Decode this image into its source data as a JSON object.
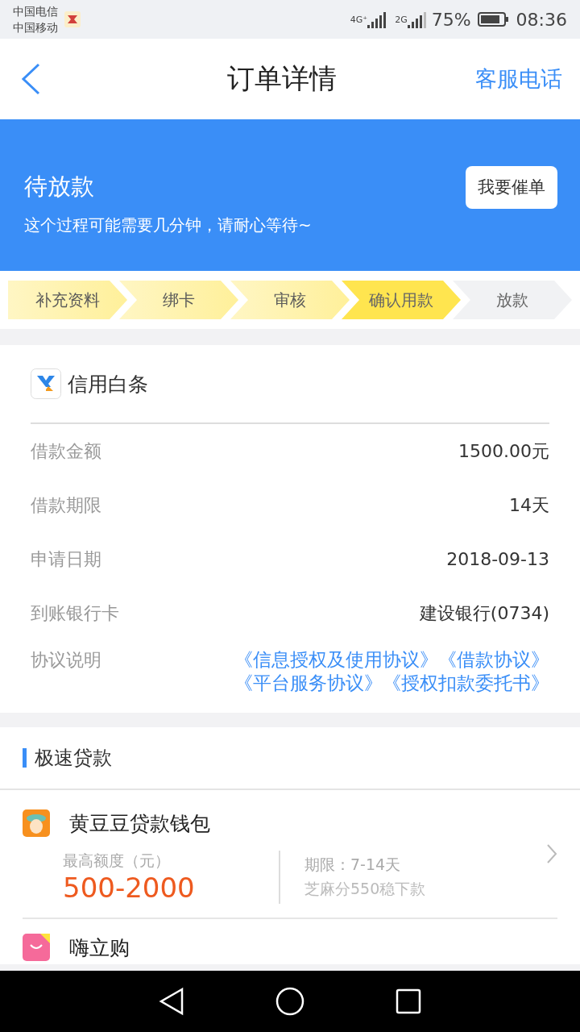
{
  "status_bar": {
    "carriers": [
      "中国电信",
      "中国移动"
    ],
    "network_1": "4G⁺",
    "network_2": "2G",
    "battery": "75%",
    "time": "08:36"
  },
  "header": {
    "title": "订单详情",
    "action": "客服电话"
  },
  "banner": {
    "title": "待放款",
    "subtitle": "这个过程可能需要几分钟，请耐心等待~",
    "button": "我要催单"
  },
  "steps": [
    {
      "label": "补充资料",
      "completed": true,
      "selected": false
    },
    {
      "label": "绑卡",
      "completed": true,
      "selected": false
    },
    {
      "label": "审核",
      "completed": true,
      "selected": false
    },
    {
      "label": "确认用款",
      "completed": false,
      "selected": true
    },
    {
      "label": "放款",
      "completed": false,
      "selected": false
    }
  ],
  "order": {
    "product": "信用白条",
    "rows": [
      {
        "label": "借款金额",
        "value": "1500.00元"
      },
      {
        "label": "借款期限",
        "value": "14天"
      },
      {
        "label": "申请日期",
        "value": "2018-09-13"
      },
      {
        "label": "到账银行卡",
        "value": "建设银行(0734)"
      }
    ],
    "agreements_label": "协议说明",
    "agreements": [
      "《信息授权及使用协议》",
      "《借款协议》",
      "《平台服务协议》",
      "《授权扣款委托书》"
    ]
  },
  "section": {
    "title": "极速贷款"
  },
  "loans": [
    {
      "name": "黄豆豆贷款钱包",
      "limit_label": "最高额度（元）",
      "limit": "500-2000",
      "term": "期限：7-14天",
      "note": "芝麻分550稳下款"
    },
    {
      "name": "嗨立购"
    }
  ]
}
